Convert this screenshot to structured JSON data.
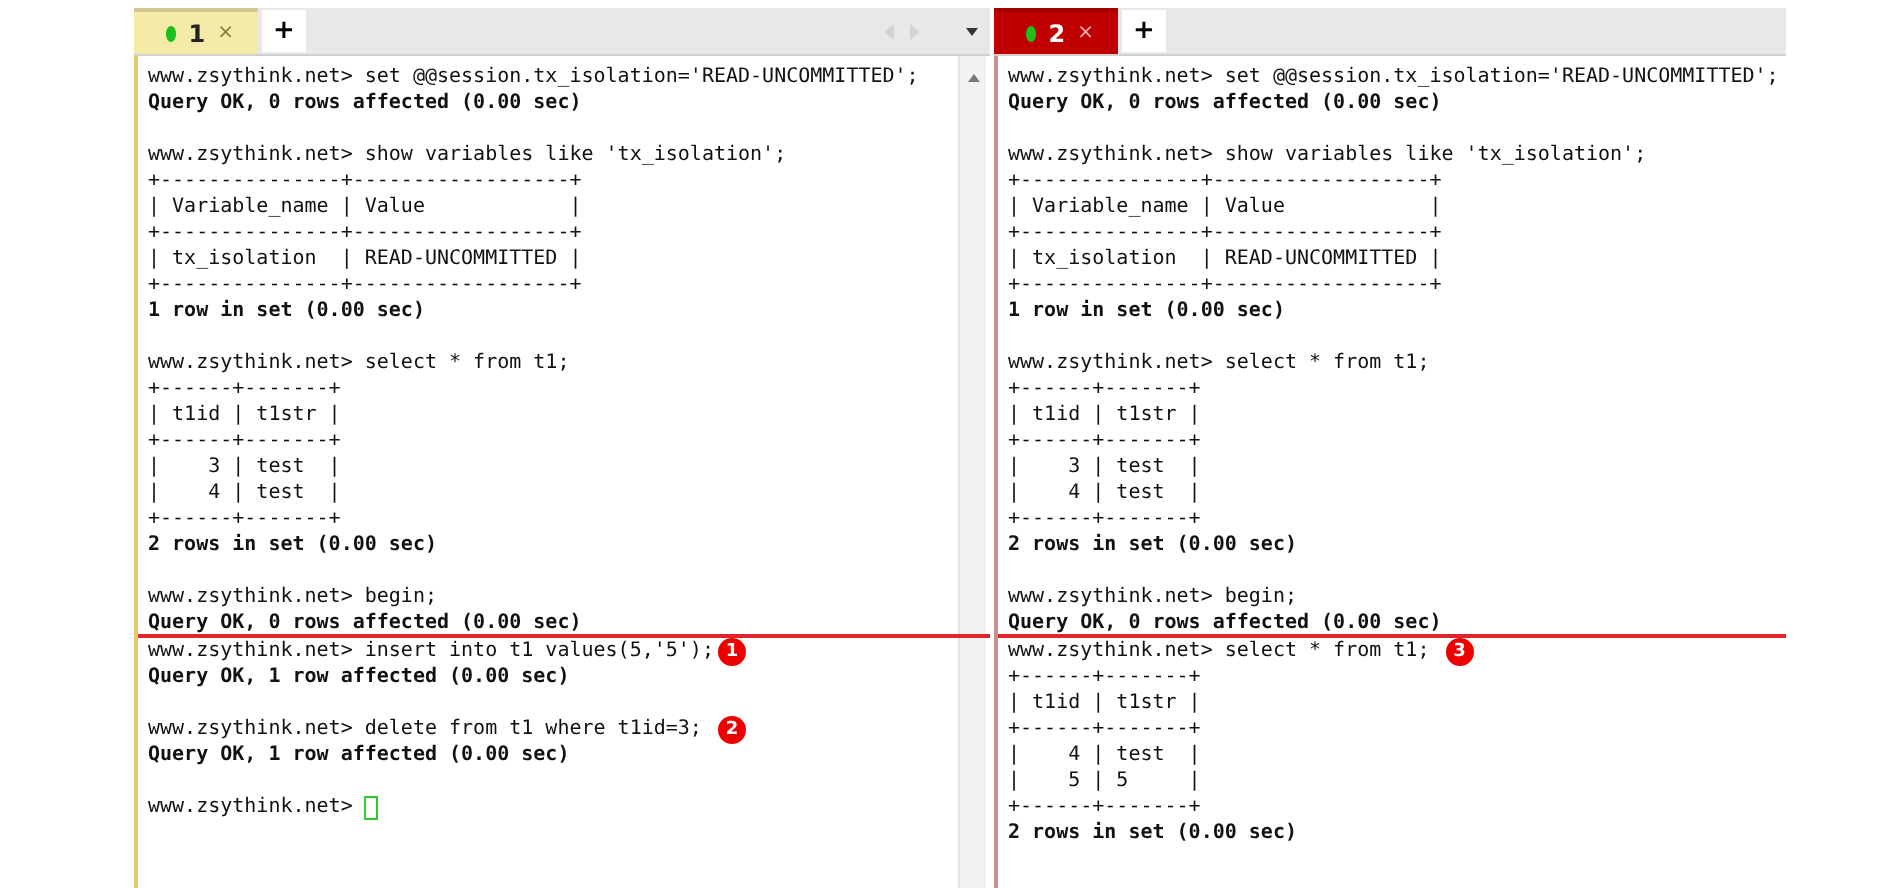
{
  "panes": [
    {
      "tab": {
        "label": "1",
        "close": "×",
        "color": "#f6eaa8"
      },
      "new_tab_button": "+",
      "scrollbar": true,
      "lines": [
        {
          "kind": "command",
          "text": "www.zsythink.net> set @@session.tx_isolation='READ-UNCOMMITTED';"
        },
        {
          "kind": "result",
          "text": "Query OK, 0 rows affected (0.00 sec)"
        },
        {
          "kind": "blank"
        },
        {
          "kind": "command",
          "text": "www.zsythink.net> show variables like 'tx_isolation';"
        },
        {
          "kind": "table",
          "text": "+---------------+------------------+"
        },
        {
          "kind": "table",
          "text": "| Variable_name | Value            |"
        },
        {
          "kind": "table",
          "text": "+---------------+------------------+"
        },
        {
          "kind": "table",
          "text": "| tx_isolation  | READ-UNCOMMITTED |"
        },
        {
          "kind": "table",
          "text": "+---------------+------------------+"
        },
        {
          "kind": "result",
          "text": "1 row in set (0.00 sec)"
        },
        {
          "kind": "blank"
        },
        {
          "kind": "command",
          "text": "www.zsythink.net> select * from t1;"
        },
        {
          "kind": "table",
          "text": "+------+-------+"
        },
        {
          "kind": "table",
          "text": "| t1id | t1str |"
        },
        {
          "kind": "table",
          "text": "+------+-------+"
        },
        {
          "kind": "table",
          "text": "|    3 | test  |"
        },
        {
          "kind": "table",
          "text": "|    4 | test  |"
        },
        {
          "kind": "table",
          "text": "+------+-------+"
        },
        {
          "kind": "result",
          "text": "2 rows in set (0.00 sec)"
        },
        {
          "kind": "blank"
        },
        {
          "kind": "command",
          "text": "www.zsythink.net> begin;"
        },
        {
          "kind": "result",
          "text": "Query OK, 0 rows affected (0.00 sec)"
        },
        {
          "kind": "divider"
        },
        {
          "kind": "command",
          "text": "www.zsythink.net> insert into t1 values(5,'5');",
          "badge": "1"
        },
        {
          "kind": "result",
          "text": "Query OK, 1 row affected (0.00 sec)"
        },
        {
          "kind": "blank"
        },
        {
          "kind": "command",
          "text": "www.zsythink.net> delete from t1 where t1id=3; ",
          "badge": "2"
        },
        {
          "kind": "result",
          "text": "Query OK, 1 row affected (0.00 sec)"
        },
        {
          "kind": "blank"
        },
        {
          "kind": "input",
          "text": "www.zsythink.net> "
        }
      ]
    },
    {
      "tab": {
        "label": "2",
        "close": "×",
        "color": "#c00000"
      },
      "new_tab_button": "+",
      "lines": [
        {
          "kind": "command",
          "text": "www.zsythink.net> set @@session.tx_isolation='READ-UNCOMMITTED';"
        },
        {
          "kind": "result",
          "text": "Query OK, 0 rows affected (0.00 sec)"
        },
        {
          "kind": "blank"
        },
        {
          "kind": "command",
          "text": "www.zsythink.net> show variables like 'tx_isolation';"
        },
        {
          "kind": "table",
          "text": "+---------------+------------------+"
        },
        {
          "kind": "table",
          "text": "| Variable_name | Value            |"
        },
        {
          "kind": "table",
          "text": "+---------------+------------------+"
        },
        {
          "kind": "table",
          "text": "| tx_isolation  | READ-UNCOMMITTED |"
        },
        {
          "kind": "table",
          "text": "+---------------+------------------+"
        },
        {
          "kind": "result",
          "text": "1 row in set (0.00 sec)"
        },
        {
          "kind": "blank"
        },
        {
          "kind": "command",
          "text": "www.zsythink.net> select * from t1;"
        },
        {
          "kind": "table",
          "text": "+------+-------+"
        },
        {
          "kind": "table",
          "text": "| t1id | t1str |"
        },
        {
          "kind": "table",
          "text": "+------+-------+"
        },
        {
          "kind": "table",
          "text": "|    3 | test  |"
        },
        {
          "kind": "table",
          "text": "|    4 | test  |"
        },
        {
          "kind": "table",
          "text": "+------+-------+"
        },
        {
          "kind": "result",
          "text": "2 rows in set (0.00 sec)"
        },
        {
          "kind": "blank"
        },
        {
          "kind": "command",
          "text": "www.zsythink.net> begin;"
        },
        {
          "kind": "result",
          "text": "Query OK, 0 rows affected (0.00 sec)"
        },
        {
          "kind": "divider"
        },
        {
          "kind": "command",
          "text": "www.zsythink.net> select * from t1; ",
          "badge": "3"
        },
        {
          "kind": "table",
          "text": "+------+-------+"
        },
        {
          "kind": "table",
          "text": "| t1id | t1str |"
        },
        {
          "kind": "table",
          "text": "+------+-------+"
        },
        {
          "kind": "table",
          "text": "|    4 | test  |"
        },
        {
          "kind": "table",
          "text": "|    5 | 5     |"
        },
        {
          "kind": "table",
          "text": "+------+-------+"
        },
        {
          "kind": "result",
          "text": "2 rows in set (0.00 sec)"
        }
      ]
    }
  ]
}
